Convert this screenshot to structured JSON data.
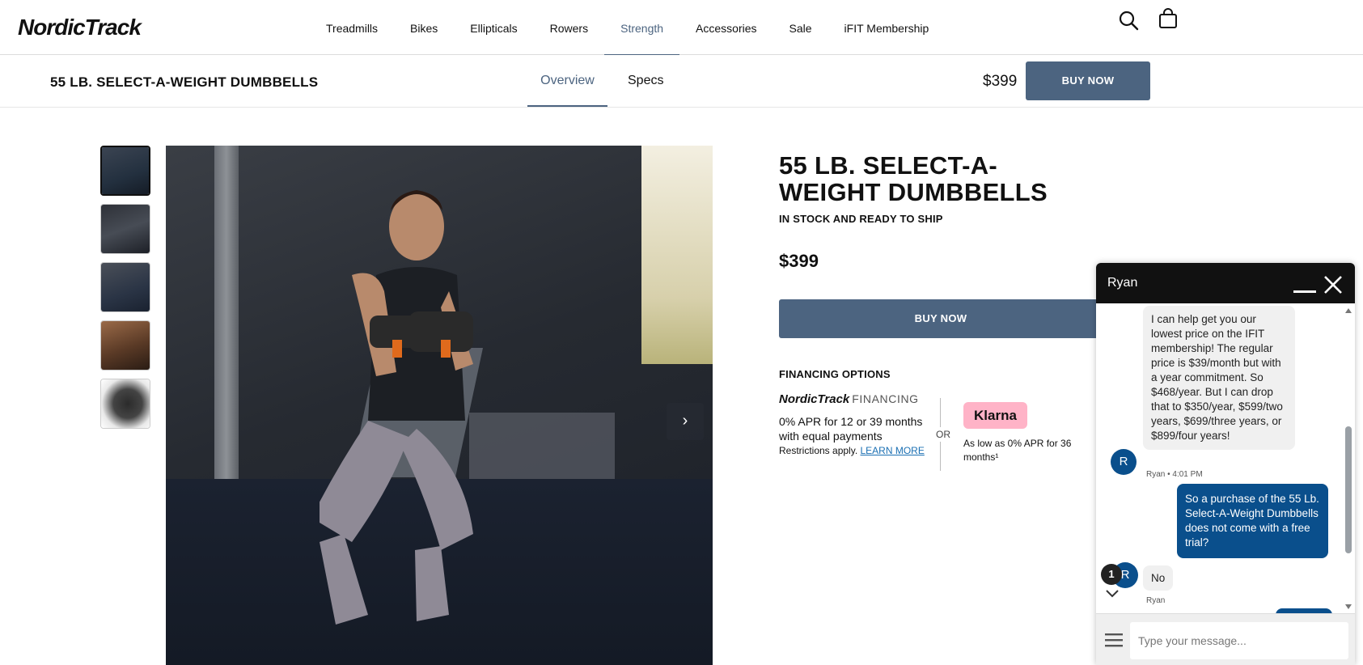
{
  "header": {
    "logo": "NordicTrack",
    "nav": [
      {
        "label": "Treadmills"
      },
      {
        "label": "Bikes"
      },
      {
        "label": "Ellipticals"
      },
      {
        "label": "Rowers"
      },
      {
        "label": "Strength",
        "active": true
      },
      {
        "label": "Accessories"
      },
      {
        "label": "Sale"
      },
      {
        "label": "iFIT Membership"
      }
    ],
    "icons": [
      "search-icon",
      "cart-icon"
    ]
  },
  "subnav": {
    "title": "55 LB. SELECT-A-WEIGHT DUMBBELLS",
    "tabs": [
      {
        "label": "Overview",
        "active": true
      },
      {
        "label": "Specs"
      }
    ],
    "price": "$399",
    "buy_label": "BUY NOW"
  },
  "gallery": {
    "thumbnail_count": 5,
    "selected_index": 0,
    "next_icon": "chevron-right-icon"
  },
  "product": {
    "title": "55 LB. SELECT-A-WEIGHT DUMBBELLS",
    "stock": "IN STOCK AND READY TO SHIP",
    "price": "$399",
    "buy_label": "BUY NOW",
    "financing": {
      "heading": "FINANCING OPTIONS",
      "brand": "NordicTrack",
      "brand_suffix": "FINANCING",
      "apr_text": "0% APR for 12 or 39 months with equal payments",
      "restrictions": "Restrictions apply.",
      "learn_more": "LEARN MORE",
      "or": "OR",
      "klarna_label": "Klarna",
      "klarna_text": "As low as 0% APR for 36 months¹"
    }
  },
  "chat": {
    "agent_name": "Ryan",
    "avatar_initial": "R",
    "messages": {
      "bot_1": "I can help get you our lowest price on the IFIT membership! The regular price is $39/month but with a year commitment. So $468/year. But I can drop that to $350/year, $599/two years, $699/three years, or $899/four years!",
      "bot_1_meta": "Ryan • 4:01 PM",
      "user_1": "So a purchase of the 55 Lb. Select-A-Weight Dumbbells does not come with a free trial?",
      "bot_2": "No",
      "bot_2_meta": "Ryan"
    },
    "unread_count": "1",
    "input_placeholder": "Type your message..."
  },
  "colors": {
    "accent": "#4c6480",
    "chat_blue": "#0a4f8c",
    "klarna_pink": "#ffb3c7",
    "link_blue": "#1a6fb3"
  }
}
